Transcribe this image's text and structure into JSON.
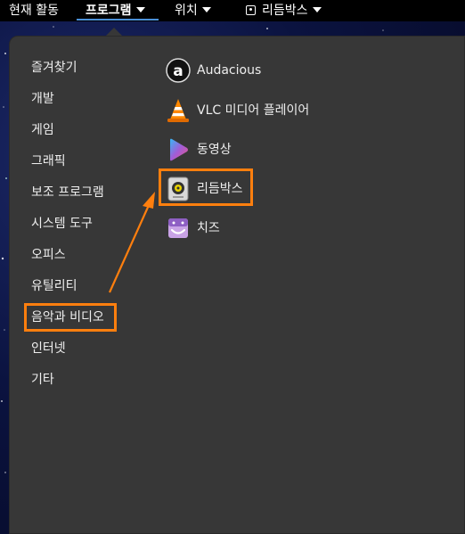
{
  "topbar": {
    "activities": "현재 활동",
    "programs": "프로그램",
    "places": "위치",
    "app_indicator": "리듬박스"
  },
  "categories": [
    {
      "label": "즐겨찾기"
    },
    {
      "label": "개발"
    },
    {
      "label": "게임"
    },
    {
      "label": "그래픽"
    },
    {
      "label": "보조 프로그램"
    },
    {
      "label": "시스템 도구"
    },
    {
      "label": "오피스"
    },
    {
      "label": "유틸리티"
    },
    {
      "label": "음악과 비디오"
    },
    {
      "label": "인터넷"
    },
    {
      "label": "기타"
    }
  ],
  "apps": [
    {
      "label": "Audacious",
      "icon": "audacious-icon"
    },
    {
      "label": "VLC 미디어 플레이어",
      "icon": "vlc-icon"
    },
    {
      "label": "동영상",
      "icon": "videos-icon"
    },
    {
      "label": "리듬박스",
      "icon": "rhythmbox-icon"
    },
    {
      "label": "치즈",
      "icon": "cheese-icon"
    }
  ],
  "colors": {
    "highlight": "#ff7f0e",
    "menu_bg": "#373737",
    "topbar_bg": "#000000",
    "underline": "#4a90d9"
  }
}
